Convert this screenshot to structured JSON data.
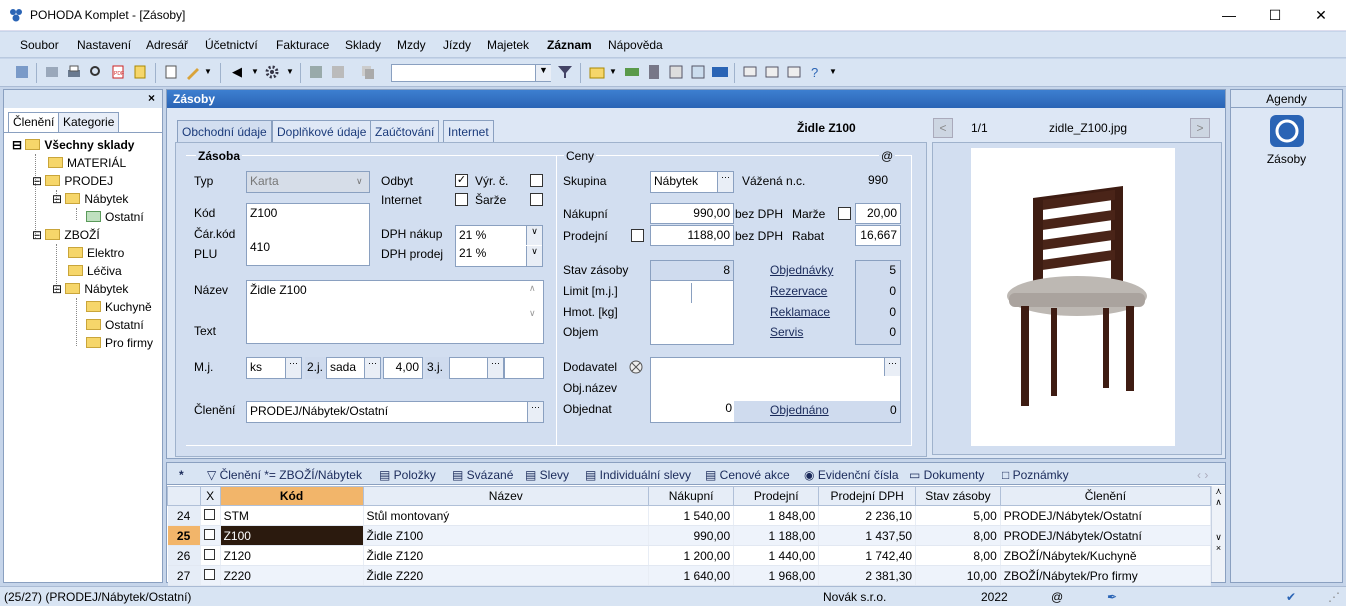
{
  "window": {
    "title": "POHODA Komplet - [Zásoby]"
  },
  "menu": [
    "Soubor",
    "Nastavení",
    "Adresář",
    "Účetnictví",
    "Fakturace",
    "Sklady",
    "Mzdy",
    "Jízdy",
    "Majetek",
    "Záznam",
    "Nápověda"
  ],
  "left": {
    "tabs": [
      "Členění",
      "Kategorie"
    ],
    "tree": {
      "root": "Všechny sklady",
      "material": "MATERIÁL",
      "prodej": "PRODEJ",
      "nabytek1": "Nábytek",
      "ostatni1": "Ostatní",
      "zbozi": "ZBOŽÍ",
      "elektro": "Elektro",
      "leciva": "Léčiva",
      "nabytek2": "Nábytek",
      "kuchyne": "Kuchyně",
      "ostatni2": "Ostatní",
      "profirmy": "Pro firmy"
    }
  },
  "main": {
    "title": "Zásoby",
    "tabs": [
      "Obchodní údaje",
      "Doplňkové údaje",
      "Zaúčtování",
      "Internet"
    ],
    "record_name": "Židle Z100",
    "group_zasoba": "Zásoba",
    "group_ceny": "Ceny",
    "at": "@",
    "typ_label": "Typ",
    "typ": "Karta",
    "odbyt_label": "Odbyt",
    "vyr_label": "Výr. č.",
    "internet_label": "Internet",
    "sarze_label": "Šarže",
    "kod_label": "Kód",
    "kod": "Z100",
    "carkod_label": "Čár.kód",
    "plu_label": "PLU",
    "plu": "410",
    "dph_nakup_label": "DPH nákup",
    "dph_nakup": "21 %",
    "dph_prodej_label": "DPH prodej",
    "dph_prodej": "21 %",
    "nazev_label": "Název",
    "nazev": "Židle Z100",
    "text_label": "Text",
    "mj_label": "M.j.",
    "mj": "ks",
    "mj2_label": "2.j.",
    "mj2": "sada",
    "mj2_qty": "4,00",
    "mj3_label": "3.j.",
    "cleneni_label": "Členění",
    "cleneni": "PRODEJ/Nábytek/Ostatní",
    "skupina_label": "Skupina",
    "skupina": "Nábytek",
    "vazena_label": "Vážená n.c.",
    "vazena": "990",
    "nakupni_label": "Nákupní",
    "nakupni": "990,00",
    "bez_dph1": "bez DPH",
    "marze_label": "Marže",
    "marze": "20,00",
    "prodejni_label": "Prodejní",
    "prodejni": "1188,00",
    "bez_dph2": "bez DPH",
    "rabat_label": "Rabat",
    "rabat": "16,667",
    "stav_label": "Stav zásoby",
    "stav": "8",
    "limit_label": "Limit  [m.j.]",
    "hmot_label": "Hmot. [kg]",
    "objem_label": "Objem",
    "objednavky_label": "Objednávky",
    "objednavky": "5",
    "rezervace_label": "Rezervace",
    "rezervace": "0",
    "reklamace_label": "Reklamace",
    "reklamace": "0",
    "servis_label": "Servis",
    "servis": "0",
    "dodavatel_label": "Dodavatel",
    "objnazev_label": "Obj.název",
    "objednat_label": "Objednat",
    "objednat": "0",
    "objednano_label": "Objednáno",
    "objednano": "0"
  },
  "image": {
    "counter": "1/1",
    "filename": "zidle_Z100.jpg"
  },
  "agenda": {
    "title": "Agendy",
    "item": "Zásoby"
  },
  "bottom": {
    "tabs": [
      "*",
      "Členění *= ZBOŽÍ/Nábytek",
      "Položky",
      "Svázané",
      "Slevy",
      "Individuální slevy",
      "Cenové akce",
      "Evidenční čísla",
      "Dokumenty",
      "Poznámky"
    ],
    "columns": [
      "",
      "X",
      "Kód",
      "Název",
      "Nákupní",
      "Prodejní",
      "Prodejní DPH",
      "Stav zásoby",
      "Členění"
    ],
    "rows": [
      [
        "24",
        "",
        "STM",
        "Stůl montovaný",
        "1 540,00",
        "1 848,00",
        "2 236,10",
        "5,00",
        "PRODEJ/Nábytek/Ostatní"
      ],
      [
        "25",
        "",
        "Z100",
        "Židle Z100",
        "990,00",
        "1 188,00",
        "1 437,50",
        "8,00",
        "PRODEJ/Nábytek/Ostatní"
      ],
      [
        "26",
        "",
        "Z120",
        "Židle Z120",
        "1 200,00",
        "1 440,00",
        "1 742,40",
        "8,00",
        "ZBOŽÍ/Nábytek/Kuchyně"
      ],
      [
        "27",
        "",
        "Z220",
        "Židle Z220",
        "1 640,00",
        "1 968,00",
        "2 381,30",
        "10,00",
        "ZBOŽÍ/Nábytek/Pro firmy"
      ]
    ]
  },
  "status": {
    "left": "(25/27) (PRODEJ/Nábytek/Ostatní)",
    "company": "Novák s.r.o.",
    "year": "2022",
    "at": "@"
  }
}
